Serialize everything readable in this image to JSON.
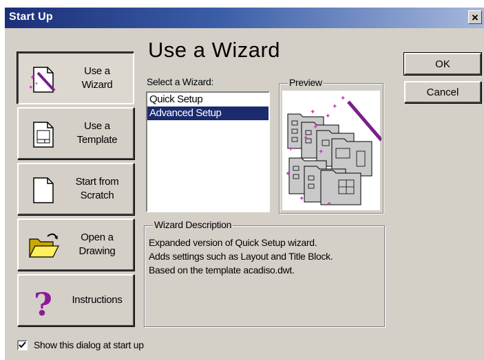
{
  "window": {
    "title": "Start Up"
  },
  "sidebar": {
    "buttons": [
      {
        "label": "Use a\nWizard",
        "icon": "wizard-icon",
        "pressed": true
      },
      {
        "label": "Use a\nTemplate",
        "icon": "template-icon",
        "pressed": false
      },
      {
        "label": "Start from\nScratch",
        "icon": "blank-page-icon",
        "pressed": false
      },
      {
        "label": "Open a\nDrawing",
        "icon": "open-folder-icon",
        "pressed": false
      },
      {
        "label": "Instructions",
        "icon": "question-mark-icon",
        "pressed": false
      }
    ]
  },
  "main": {
    "heading": "Use a Wizard",
    "select_label": "Select a Wizard:",
    "wizards": [
      "Quick Setup",
      "Advanced Setup"
    ],
    "selected_index": 1,
    "preview_label": "Preview",
    "description_label": "Wizard Description",
    "description": "Expanded version of Quick Setup wizard.\nAdds settings such as Layout and Title Block.\nBased on the template acadiso.dwt."
  },
  "actions": {
    "ok_label": "OK",
    "cancel_label": "Cancel"
  },
  "footer": {
    "show_at_startup_label": "Show this dialog at start up",
    "show_at_startup_checked": true
  },
  "colors": {
    "title_gradient_start": "#1c2f78",
    "title_gradient_end": "#a6b8dc",
    "face": "#d4d0c8",
    "selection": "#1c2b6e",
    "wand": "#7a1f8c"
  }
}
